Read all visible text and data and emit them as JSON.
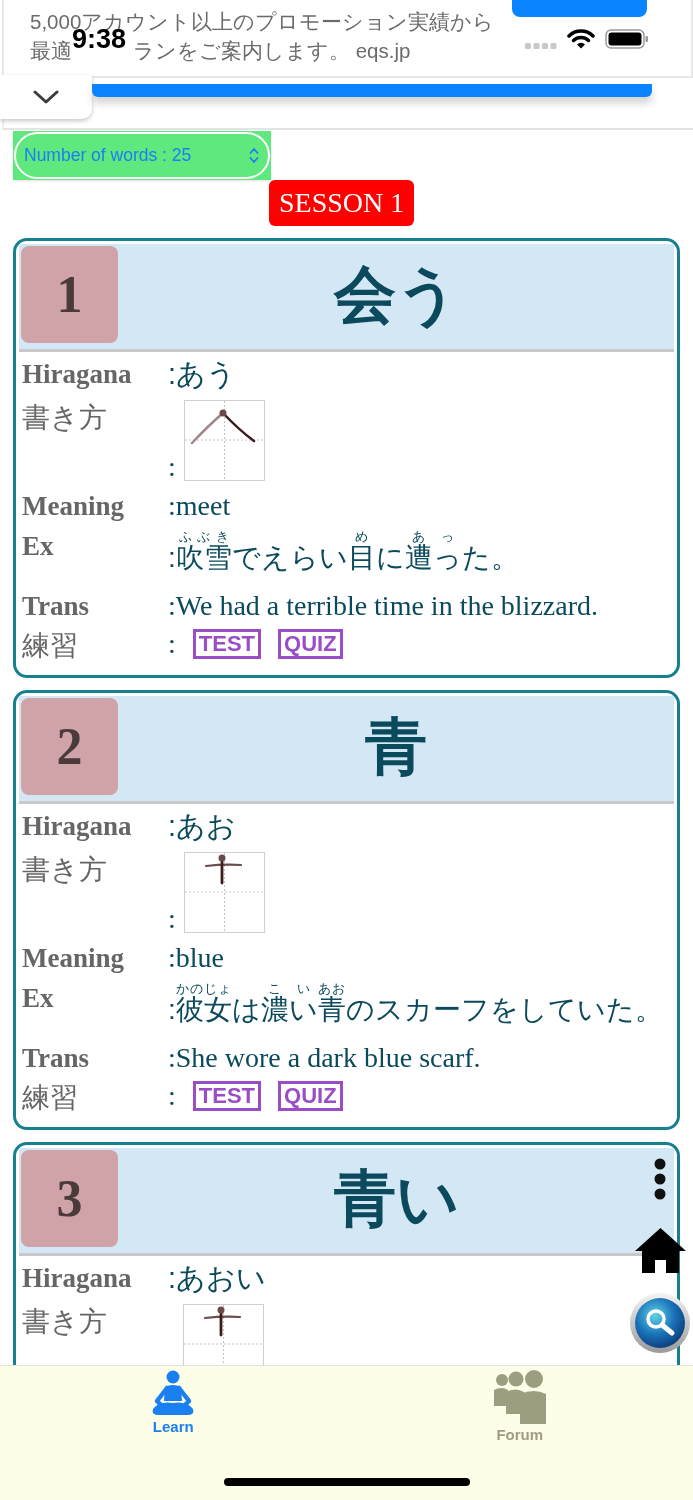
{
  "status_bar": {
    "time": "9:38"
  },
  "ad": {
    "lines": [
      {
        "parts": [
          "5,000アカウント以上のプロモーション実績から"
        ]
      },
      {
        "parts": [
          "最適",
          "ランをご案内します。 eqs.jp"
        ]
      }
    ]
  },
  "word_count_select": {
    "value": "Number of words : 25"
  },
  "session": "SESSON 1",
  "cards": [
    {
      "number": "1",
      "word": "会う",
      "rows": [
        {
          "kind": "reading",
          "label": "Hiragana",
          "value": ":あう"
        },
        {
          "kind": "stroke",
          "label": "書き方",
          "colon": ":",
          "stroke_image": {
            "kind": "peak"
          }
        },
        {
          "kind": "meaning",
          "label": "Meaning",
          "value": ":meet"
        },
        {
          "kind": "example",
          "label": "Ex",
          "segments": [
            {
              "text": ":"
            },
            {
              "text": "吹雪",
              "ruby": "ふぶき"
            },
            {
              "text": "でえらい"
            },
            {
              "text": "目",
              "ruby": "め"
            },
            {
              "text": "に"
            },
            {
              "text": "遭",
              "ruby": "あ"
            },
            {
              "text": "っ",
              "ruby": "っ"
            },
            {
              "text": "た。"
            }
          ]
        },
        {
          "kind": "translation",
          "label": "Trans",
          "value": ":We had a terrible time in the blizzard."
        },
        {
          "kind": "practice",
          "label": "練習",
          "colon": ":",
          "buttons": [
            "TEST",
            "QUIZ"
          ]
        }
      ]
    },
    {
      "number": "2",
      "word": "青",
      "rows": [
        {
          "kind": "reading",
          "label": "Hiragana",
          "value": ":あお"
        },
        {
          "kind": "stroke",
          "label": "書き方",
          "colon": ":",
          "stroke_image": {
            "kind": "cross"
          }
        },
        {
          "kind": "meaning",
          "label": "Meaning",
          "value": ":blue"
        },
        {
          "kind": "example",
          "label": "Ex",
          "segments": [
            {
              "text": ":"
            },
            {
              "text": "彼女",
              "ruby": "かのじょ"
            },
            {
              "text": "は"
            },
            {
              "text": "濃",
              "ruby": "こ"
            },
            {
              "text": "い",
              "ruby": "い"
            },
            {
              "text": "青",
              "ruby": "あお"
            },
            {
              "text": "のスカーフをしていた。"
            }
          ]
        },
        {
          "kind": "translation",
          "label": "Trans",
          "value": ":She wore a dark blue scarf."
        },
        {
          "kind": "practice",
          "label": "練習",
          "colon": ":",
          "buttons": [
            "TEST",
            "QUIZ"
          ]
        }
      ]
    },
    {
      "number": "3",
      "word": "青い",
      "rows": [
        {
          "kind": "reading",
          "label": "Hiragana",
          "value": ":あおい"
        },
        {
          "kind": "stroke",
          "label": "書き方",
          "stroke_image": {
            "kind": "cross"
          }
        }
      ]
    }
  ],
  "tabs": [
    {
      "label": "Learn",
      "kind": "learn",
      "selected": true
    },
    {
      "label": "Forum",
      "kind": "forum",
      "selected": false
    }
  ]
}
